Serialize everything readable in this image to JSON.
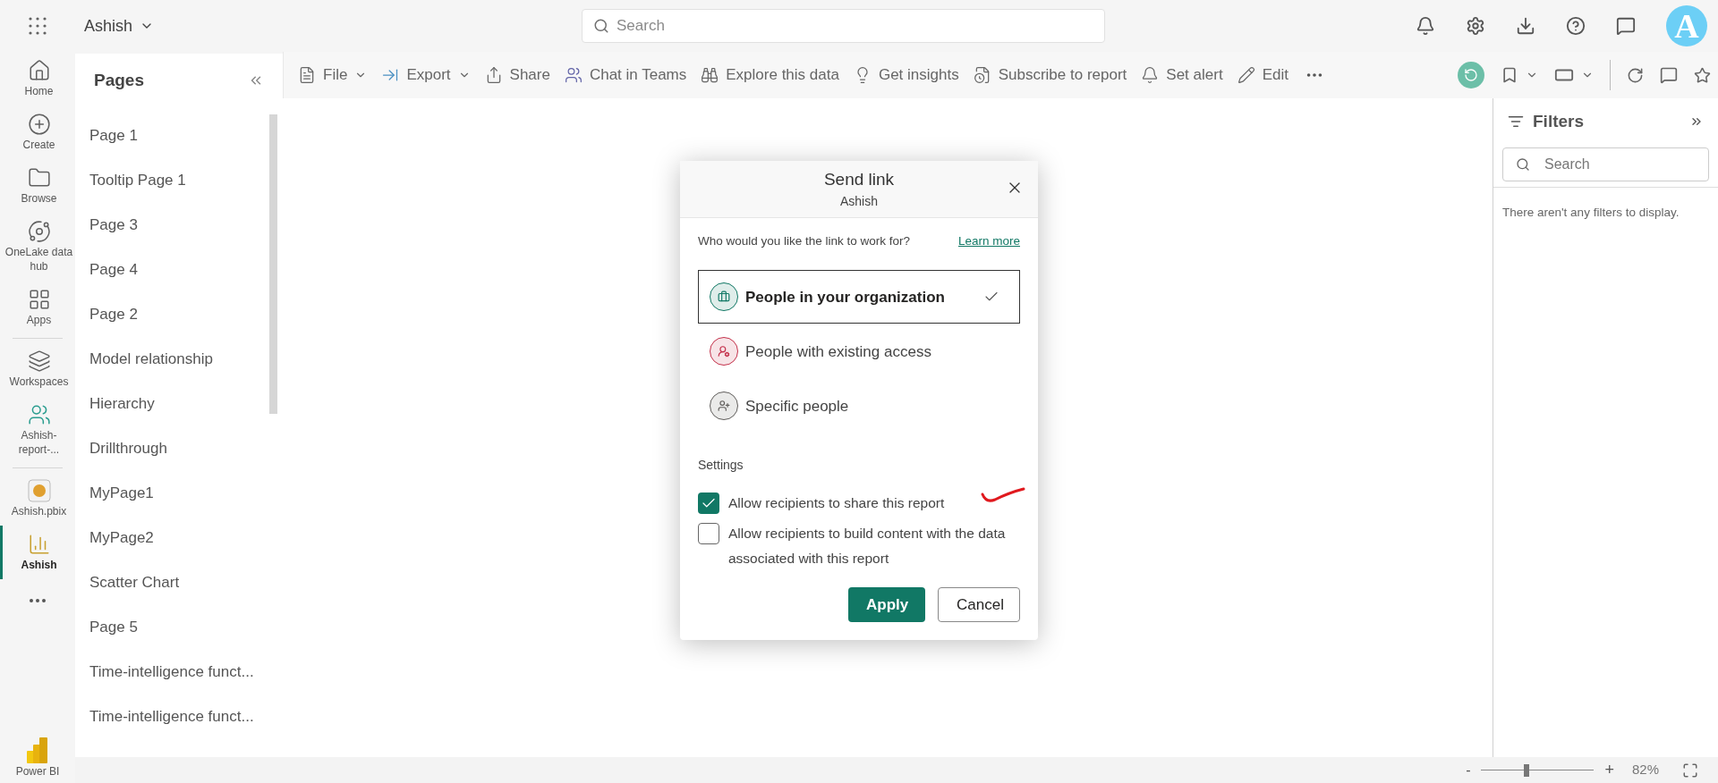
{
  "app_bar": {
    "workspace": "Ashish",
    "search": {
      "placeholder": "Search"
    },
    "avatar": "A"
  },
  "nav": [
    {
      "label": "Home",
      "selected": false
    },
    {
      "label": "Create",
      "selected": false
    },
    {
      "label": "Browse",
      "selected": false
    },
    {
      "label": "OneLake data hub",
      "selected": false
    },
    {
      "label": "Apps",
      "selected": false
    },
    {
      "label": "Workspaces",
      "selected": false
    },
    {
      "label": "Ashish-report-...",
      "selected": false
    },
    {
      "label": "Ashish.pbix",
      "selected": false
    },
    {
      "label": "Ashish",
      "selected": true
    }
  ],
  "brand": "Power BI",
  "pages": {
    "title": "Pages",
    "items": [
      "Page 1",
      "Tooltip Page 1",
      "Page 3",
      "Page 4",
      "Page 2",
      "Model relationship",
      "Hierarchy",
      "Drillthrough",
      "MyPage1",
      "MyPage2",
      "Scatter Chart",
      "Page 5",
      "Time-intelligence funct...",
      "Time-intelligence funct..."
    ]
  },
  "toolbar": {
    "items": [
      {
        "label": "File",
        "dropdown": true
      },
      {
        "label": "Export",
        "dropdown": true
      },
      {
        "label": "Share",
        "dropdown": false
      },
      {
        "label": "Chat in Teams",
        "dropdown": false
      },
      {
        "label": "Explore this data",
        "dropdown": false
      },
      {
        "label": "Get insights",
        "dropdown": false
      },
      {
        "label": "Subscribe to report",
        "dropdown": false
      },
      {
        "label": "Set alert",
        "dropdown": false
      },
      {
        "label": "Edit",
        "dropdown": false
      }
    ]
  },
  "dialog": {
    "title": "Send link",
    "subtitle": "Ashish",
    "question": "Who would you like the link to work for?",
    "link": "Learn more",
    "options": [
      {
        "label": "People in your organization",
        "selected": true,
        "color": "#117865"
      },
      {
        "label": "People with existing access",
        "selected": false,
        "color": "#c4314b"
      },
      {
        "label": "Specific people",
        "selected": false,
        "color": "#605e5c"
      }
    ],
    "settings_title": "Settings",
    "settings": [
      {
        "label": "Allow recipients to share this report",
        "checked": true
      },
      {
        "label": "Allow recipients to build content with the data associated with this report",
        "checked": false
      }
    ],
    "buttons": [
      {
        "label": "Apply",
        "kind": "primary"
      },
      {
        "label": "Cancel",
        "kind": "secondary"
      }
    ]
  },
  "filters": {
    "title": "Filters",
    "search": {
      "placeholder": "Search"
    },
    "empty": "There aren't any filters to display."
  },
  "zoom": {
    "minus": "-",
    "plus": "+",
    "level": 0.4,
    "reading": "82%"
  }
}
